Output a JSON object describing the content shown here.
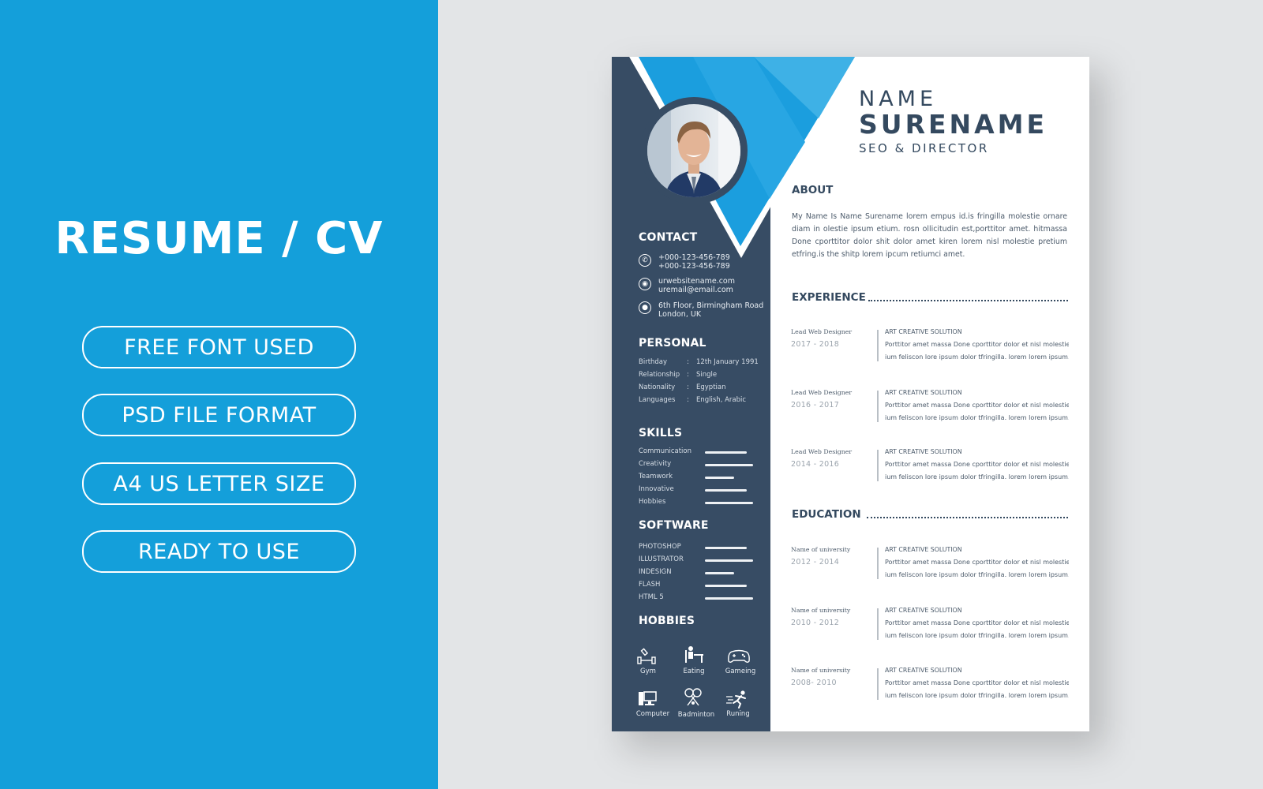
{
  "promo": {
    "title": "RESUME / CV",
    "features": [
      "FREE FONT USED",
      "PSD FILE FORMAT",
      "A4 US LETTER SIZE",
      "READY TO USE"
    ],
    "background_color": "#149fda"
  },
  "resume": {
    "colors": {
      "sidebar": "#374c64",
      "accent": "#1b9ede",
      "accent_light": "#3eb1e6",
      "text_dark": "#34495f"
    },
    "header": {
      "first_name": "NAME",
      "last_name": "SURENAME",
      "job_title": "SEO & DIRECTOR"
    },
    "photo": {
      "alt": "Profile photo of smiling man in suit"
    },
    "contact": {
      "heading": "CONTACT",
      "items": [
        {
          "icon": "phone-icon",
          "lines": [
            "+000-123-456-789",
            "+000-123-456-789"
          ]
        },
        {
          "icon": "globe-icon",
          "lines": [
            "urwebsitename.com",
            "uremail@email.com"
          ]
        },
        {
          "icon": "location-pin-icon",
          "lines": [
            "6th Floor, Birmingham Road",
            "London, UK"
          ]
        }
      ]
    },
    "personal": {
      "heading": "PERSONAL",
      "rows": [
        {
          "label": "Birthday",
          "value": "12th January 1991"
        },
        {
          "label": "Relationship",
          "value": "Single"
        },
        {
          "label": "Nationality",
          "value": "Egyptian"
        },
        {
          "label": "Languages",
          "value": "English, Arabic"
        }
      ]
    },
    "skills": {
      "heading": "SKILLS",
      "items": [
        {
          "name": "Communication",
          "level": 0.87
        },
        {
          "name": "Creativity",
          "level": 1.0
        },
        {
          "name": "Teamwork",
          "level": 0.6
        },
        {
          "name": "Innovative",
          "level": 0.87
        },
        {
          "name": "Hobbies",
          "level": 1.0
        }
      ]
    },
    "software": {
      "heading": "SOFTWARE",
      "items": [
        {
          "name": "PHOTOSHOP",
          "level": 0.87
        },
        {
          "name": "ILLUSTRATOR",
          "level": 1.0
        },
        {
          "name": "INDESIGN",
          "level": 0.6
        },
        {
          "name": "FLASH",
          "level": 0.87
        },
        {
          "name": "HTML 5",
          "level": 1.0
        }
      ]
    },
    "hobbies": {
      "heading": "HOBBIES",
      "items": [
        {
          "name": "Gym",
          "icon": "dumbbell-icon"
        },
        {
          "name": "Eating",
          "icon": "dining-icon"
        },
        {
          "name": "Gameing",
          "icon": "gamepad-icon"
        },
        {
          "name": "Computer",
          "icon": "computer-icon"
        },
        {
          "name": "Badminton",
          "icon": "badminton-icon"
        },
        {
          "name": "Runing",
          "icon": "running-icon"
        }
      ]
    },
    "about": {
      "heading": "ABOUT",
      "text": "My Name Is Name Surename lorem empus id.is fringilla molestie ornare diam in olestie ipsum etium. rosn ollicitudin est,porttitor amet. hitmassa Done cporttitor dolor shit dolor amet kiren lorem nisl molestie pretium etfring.is the shitp lorem ipcum retiumci amet."
    },
    "experience": {
      "heading": "EXPERIENCE",
      "entries": [
        {
          "role": "Lead  Web Designer",
          "dates": "2017 - 2018",
          "company": "ART CREATIVE SOLUTION",
          "desc": [
            "Porttitor amet massa Done cporttitor dolor et nisl molestie",
            "ium feliscon lore  ipsum dolor tfringilla. lorem lorem ipsum."
          ]
        },
        {
          "role": "Lead  Web Designer",
          "dates": "2016 - 2017",
          "company": "ART CREATIVE SOLUTION",
          "desc": [
            "Porttitor amet massa Done cporttitor dolor et nisl molestie",
            "ium feliscon lore  ipsum dolor tfringilla. lorem lorem ipsum."
          ]
        },
        {
          "role": "Lead  Web Designer",
          "dates": "2014 - 2016",
          "company": "ART CREATIVE SOLUTION",
          "desc": [
            "Porttitor amet massa Done cporttitor dolor et nisl molestie",
            "ium feliscon lore  ipsum dolor tfringilla. lorem lorem ipsum."
          ]
        }
      ]
    },
    "education": {
      "heading": "EDUCATION",
      "entries": [
        {
          "role": "Name of university",
          "dates": "2012 - 2014",
          "company": "ART CREATIVE SOLUTION",
          "desc": [
            "Porttitor amet massa Done cporttitor dolor et nisl molestie",
            "ium feliscon lore  ipsum dolor tfringilla. lorem lorem ipsum."
          ]
        },
        {
          "role": "Name of university",
          "dates": "2010 - 2012",
          "company": "ART CREATIVE SOLUTION",
          "desc": [
            "Porttitor amet massa Done cporttitor dolor et nisl molestie",
            "ium feliscon lore  ipsum dolor tfringilla. lorem lorem ipsum."
          ]
        },
        {
          "role": "Name of university",
          "dates": " 2008- 2010",
          "company": "ART CREATIVE SOLUTION",
          "desc": [
            "Porttitor amet massa Done cporttitor dolor et nisl molestie",
            "ium feliscon lore  ipsum dolor tfringilla. lorem lorem ipsum."
          ]
        }
      ]
    }
  }
}
